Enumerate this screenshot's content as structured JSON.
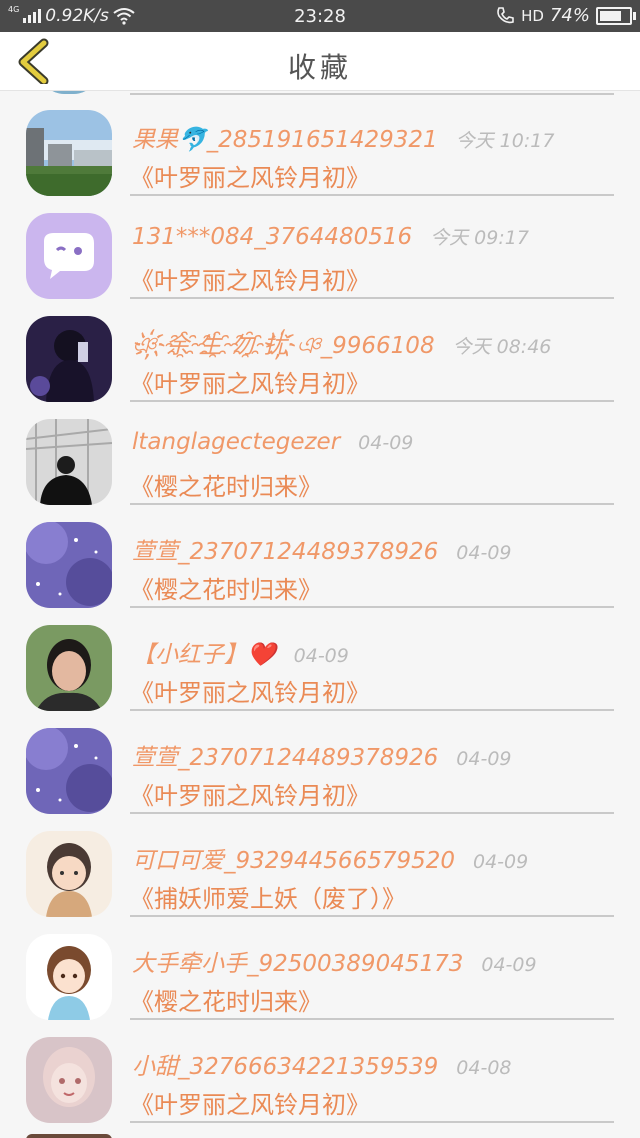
{
  "status_bar": {
    "network": "4G",
    "speed": "0.92K/s",
    "time": "23:28",
    "hd": "HD",
    "battery_text": "74%",
    "battery_level": 0.74
  },
  "header": {
    "title": "收藏",
    "back_icon": "chevron-left-icon"
  },
  "colors": {
    "accent": "#f09868",
    "time_text": "#bbbbbb",
    "back_chevron": "#e3cc3e"
  },
  "rows": [
    {
      "author": "果果🐬_285191651429321",
      "time": "今天 10:17",
      "book": "《叶罗丽之风铃月初》"
    },
    {
      "author": "131***084_3764480516",
      "time": "今天 09:17",
      "book": "《叶罗丽之风铃月初》"
    },
    {
      "author": "ঞ҉余҈生҈勿҈扰҉ঞ_9966108",
      "time": "今天 08:46",
      "book": "《叶罗丽之风铃月初》"
    },
    {
      "author": "ltanglagectegezer",
      "time": "04-09",
      "book": "《樱之花时归来》"
    },
    {
      "author": "萱萱_23707124489378926",
      "time": "04-09",
      "book": "《樱之花时归来》"
    },
    {
      "author": "【小红子】❤️",
      "time": "04-09",
      "book": "《叶罗丽之风铃月初》"
    },
    {
      "author": "萱萱_23707124489378926",
      "time": "04-09",
      "book": "《叶罗丽之风铃月初》"
    },
    {
      "author": "可口可爱_932944566579520",
      "time": "04-09",
      "book": "《捕妖师爱上妖（废了）》"
    },
    {
      "author": "大手牵小手_92500389045173",
      "time": "04-09",
      "book": "《樱之花时归来》"
    },
    {
      "author": "小甜_32766634221359539",
      "time": "04-08",
      "book": "《叶罗丽之风铃月初》"
    }
  ]
}
